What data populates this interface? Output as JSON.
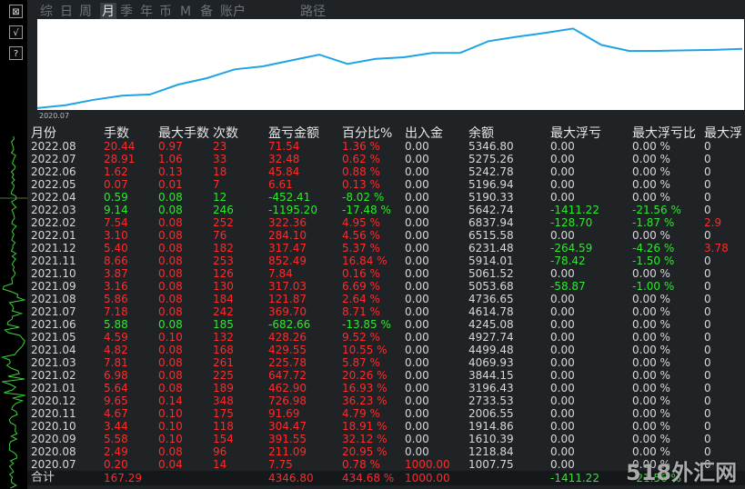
{
  "toolbar": {
    "btn1": "⊠",
    "btn2": "√",
    "btn3": "?"
  },
  "tabs": [
    "综",
    "日",
    "周",
    "月",
    "季",
    "年",
    "币",
    "M",
    "备",
    "账户",
    "路径"
  ],
  "active_tab": "月",
  "chart": {
    "start_label": "2020.07",
    "line_color": "#1fa3e6",
    "values": [
      1007.75,
      1218.84,
      1610.39,
      1914.86,
      2006.55,
      2733.53,
      3196.43,
      3844.15,
      4069.93,
      4499.48,
      4927.74,
      4245.08,
      4614.78,
      4736.65,
      5053.68,
      5061.52,
      5914.01,
      6231.48,
      6515.58,
      6837.94,
      5642.74,
      5190.33,
      5196.94,
      5242.78,
      5275.26,
      5346.8
    ]
  },
  "columns": [
    "月份",
    "手数",
    "最大手数",
    "次数",
    "盈亏金额",
    "百分比%",
    "出入金",
    "余额",
    "最大浮亏",
    "最大浮亏比",
    "最大浮"
  ],
  "rows": [
    {
      "month": "2022.08",
      "lots": "20.44",
      "maxlots": "0.97",
      "count": "23",
      "pnl": "71.54",
      "pct": "1.36 %",
      "flow": "0.00",
      "bal": "5346.80",
      "dd": "0.00",
      "ddpct": "0.00 %",
      "x": "0",
      "tone": "red"
    },
    {
      "month": "2022.07",
      "lots": "28.91",
      "maxlots": "1.06",
      "count": "33",
      "pnl": "32.48",
      "pct": "0.62 %",
      "flow": "0.00",
      "bal": "5275.26",
      "dd": "0.00",
      "ddpct": "0.00 %",
      "x": "0",
      "tone": "red"
    },
    {
      "month": "2022.06",
      "lots": "1.62",
      "maxlots": "0.13",
      "count": "18",
      "pnl": "45.84",
      "pct": "0.88 %",
      "flow": "0.00",
      "bal": "5242.78",
      "dd": "0.00",
      "ddpct": "0.00 %",
      "x": "0",
      "tone": "red"
    },
    {
      "month": "2022.05",
      "lots": "0.07",
      "maxlots": "0.01",
      "count": "7",
      "pnl": "6.61",
      "pct": "0.13 %",
      "flow": "0.00",
      "bal": "5196.94",
      "dd": "0.00",
      "ddpct": "0.00 %",
      "x": "0",
      "tone": "red"
    },
    {
      "month": "2022.04",
      "lots": "0.59",
      "maxlots": "0.08",
      "count": "12",
      "pnl": "-452.41",
      "pct": "-8.02 %",
      "flow": "0.00",
      "bal": "5190.33",
      "dd": "0.00",
      "ddpct": "0.00 %",
      "x": "0",
      "tone": "grn"
    },
    {
      "month": "2022.03",
      "lots": "9.14",
      "maxlots": "0.08",
      "count": "246",
      "pnl": "-1195.20",
      "pct": "-17.48 %",
      "flow": "0.00",
      "bal": "5642.74",
      "dd": "-1411.22",
      "ddpct": "-21.56 %",
      "x": "0",
      "tone": "grn",
      "ddtone": "grn"
    },
    {
      "month": "2022.02",
      "lots": "7.54",
      "maxlots": "0.08",
      "count": "252",
      "pnl": "322.36",
      "pct": "4.95 %",
      "flow": "0.00",
      "bal": "6837.94",
      "dd": "-128.70",
      "ddpct": "-1.87 %",
      "x": "2.9",
      "tone": "red",
      "ddtone": "grn",
      "xtone": "red"
    },
    {
      "month": "2022.01",
      "lots": "3.10",
      "maxlots": "0.08",
      "count": "76",
      "pnl": "284.10",
      "pct": "4.56 %",
      "flow": "0.00",
      "bal": "6515.58",
      "dd": "0.00",
      "ddpct": "0.00 %",
      "x": "0",
      "tone": "red"
    },
    {
      "month": "2021.12",
      "lots": "5.40",
      "maxlots": "0.08",
      "count": "182",
      "pnl": "317.47",
      "pct": "5.37 %",
      "flow": "0.00",
      "bal": "6231.48",
      "dd": "-264.59",
      "ddpct": "-4.26 %",
      "x": "3.78",
      "tone": "red",
      "ddtone": "grn",
      "xtone": "red"
    },
    {
      "month": "2021.11",
      "lots": "8.66",
      "maxlots": "0.08",
      "count": "253",
      "pnl": "852.49",
      "pct": "16.84 %",
      "flow": "0.00",
      "bal": "5914.01",
      "dd": "-78.42",
      "ddpct": "-1.50 %",
      "x": "0",
      "tone": "red",
      "ddtone": "grn"
    },
    {
      "month": "2021.10",
      "lots": "3.87",
      "maxlots": "0.08",
      "count": "126",
      "pnl": "7.84",
      "pct": "0.16 %",
      "flow": "0.00",
      "bal": "5061.52",
      "dd": "0.00",
      "ddpct": "0.00 %",
      "x": "0",
      "tone": "red"
    },
    {
      "month": "2021.09",
      "lots": "3.16",
      "maxlots": "0.08",
      "count": "130",
      "pnl": "317.03",
      "pct": "6.69 %",
      "flow": "0.00",
      "bal": "5053.68",
      "dd": "-58.87",
      "ddpct": "-1.00 %",
      "x": "0",
      "tone": "red",
      "ddtone": "grn"
    },
    {
      "month": "2021.08",
      "lots": "5.86",
      "maxlots": "0.08",
      "count": "184",
      "pnl": "121.87",
      "pct": "2.64 %",
      "flow": "0.00",
      "bal": "4736.65",
      "dd": "0.00",
      "ddpct": "0.00 %",
      "x": "0",
      "tone": "red"
    },
    {
      "month": "2021.07",
      "lots": "7.18",
      "maxlots": "0.08",
      "count": "242",
      "pnl": "369.70",
      "pct": "8.71 %",
      "flow": "0.00",
      "bal": "4614.78",
      "dd": "0.00",
      "ddpct": "0.00 %",
      "x": "0",
      "tone": "red"
    },
    {
      "month": "2021.06",
      "lots": "5.88",
      "maxlots": "0.08",
      "count": "185",
      "pnl": "-682.66",
      "pct": "-13.85 %",
      "flow": "0.00",
      "bal": "4245.08",
      "dd": "0.00",
      "ddpct": "0.00 %",
      "x": "0",
      "tone": "grn"
    },
    {
      "month": "2021.05",
      "lots": "4.59",
      "maxlots": "0.10",
      "count": "132",
      "pnl": "428.26",
      "pct": "9.52 %",
      "flow": "0.00",
      "bal": "4927.74",
      "dd": "0.00",
      "ddpct": "0.00 %",
      "x": "0",
      "tone": "red"
    },
    {
      "month": "2021.04",
      "lots": "4.82",
      "maxlots": "0.08",
      "count": "168",
      "pnl": "429.55",
      "pct": "10.55 %",
      "flow": "0.00",
      "bal": "4499.48",
      "dd": "0.00",
      "ddpct": "0.00 %",
      "x": "0",
      "tone": "red"
    },
    {
      "month": "2021.03",
      "lots": "7.81",
      "maxlots": "0.08",
      "count": "261",
      "pnl": "225.78",
      "pct": "5.87 %",
      "flow": "0.00",
      "bal": "4069.93",
      "dd": "0.00",
      "ddpct": "0.00 %",
      "x": "0",
      "tone": "red"
    },
    {
      "month": "2021.02",
      "lots": "6.98",
      "maxlots": "0.08",
      "count": "225",
      "pnl": "647.72",
      "pct": "20.26 %",
      "flow": "0.00",
      "bal": "3844.15",
      "dd": "0.00",
      "ddpct": "0.00 %",
      "x": "0",
      "tone": "red"
    },
    {
      "month": "2021.01",
      "lots": "5.64",
      "maxlots": "0.08",
      "count": "189",
      "pnl": "462.90",
      "pct": "16.93 %",
      "flow": "0.00",
      "bal": "3196.43",
      "dd": "0.00",
      "ddpct": "0.00 %",
      "x": "0",
      "tone": "red"
    },
    {
      "month": "2020.12",
      "lots": "9.65",
      "maxlots": "0.14",
      "count": "348",
      "pnl": "726.98",
      "pct": "36.23 %",
      "flow": "0.00",
      "bal": "2733.53",
      "dd": "0.00",
      "ddpct": "0.00 %",
      "x": "0",
      "tone": "red"
    },
    {
      "month": "2020.11",
      "lots": "4.67",
      "maxlots": "0.10",
      "count": "175",
      "pnl": "91.69",
      "pct": "4.79 %",
      "flow": "0.00",
      "bal": "2006.55",
      "dd": "0.00",
      "ddpct": "0.00 %",
      "x": "0",
      "tone": "red"
    },
    {
      "month": "2020.10",
      "lots": "3.44",
      "maxlots": "0.10",
      "count": "118",
      "pnl": "304.47",
      "pct": "18.91 %",
      "flow": "0.00",
      "bal": "1914.86",
      "dd": "0.00",
      "ddpct": "0.00 %",
      "x": "0",
      "tone": "red"
    },
    {
      "month": "2020.09",
      "lots": "5.58",
      "maxlots": "0.10",
      "count": "154",
      "pnl": "391.55",
      "pct": "32.12 %",
      "flow": "0.00",
      "bal": "1610.39",
      "dd": "0.00",
      "ddpct": "0.00 %",
      "x": "0",
      "tone": "red"
    },
    {
      "month": "2020.08",
      "lots": "2.49",
      "maxlots": "0.08",
      "count": "96",
      "pnl": "211.09",
      "pct": "20.95 %",
      "flow": "0.00",
      "bal": "1218.84",
      "dd": "0.00",
      "ddpct": "0.00 %",
      "x": "0",
      "tone": "red"
    },
    {
      "month": "2020.07",
      "lots": "0.20",
      "maxlots": "0.04",
      "count": "14",
      "pnl": "7.75",
      "pct": "0.78 %",
      "flow": "1000.00",
      "bal": "1007.75",
      "dd": "0.00",
      "ddpct": "0.00 %",
      "x": "0",
      "tone": "red",
      "flowtone": "red"
    }
  ],
  "summary": {
    "label": "合计",
    "lots": "167.29",
    "pnl": "4346.80",
    "pct": "434.68 %",
    "flow": "1000.00",
    "dd": "-1411.22",
    "ddpct": "-21.56 %"
  },
  "watermark": "518外汇网"
}
